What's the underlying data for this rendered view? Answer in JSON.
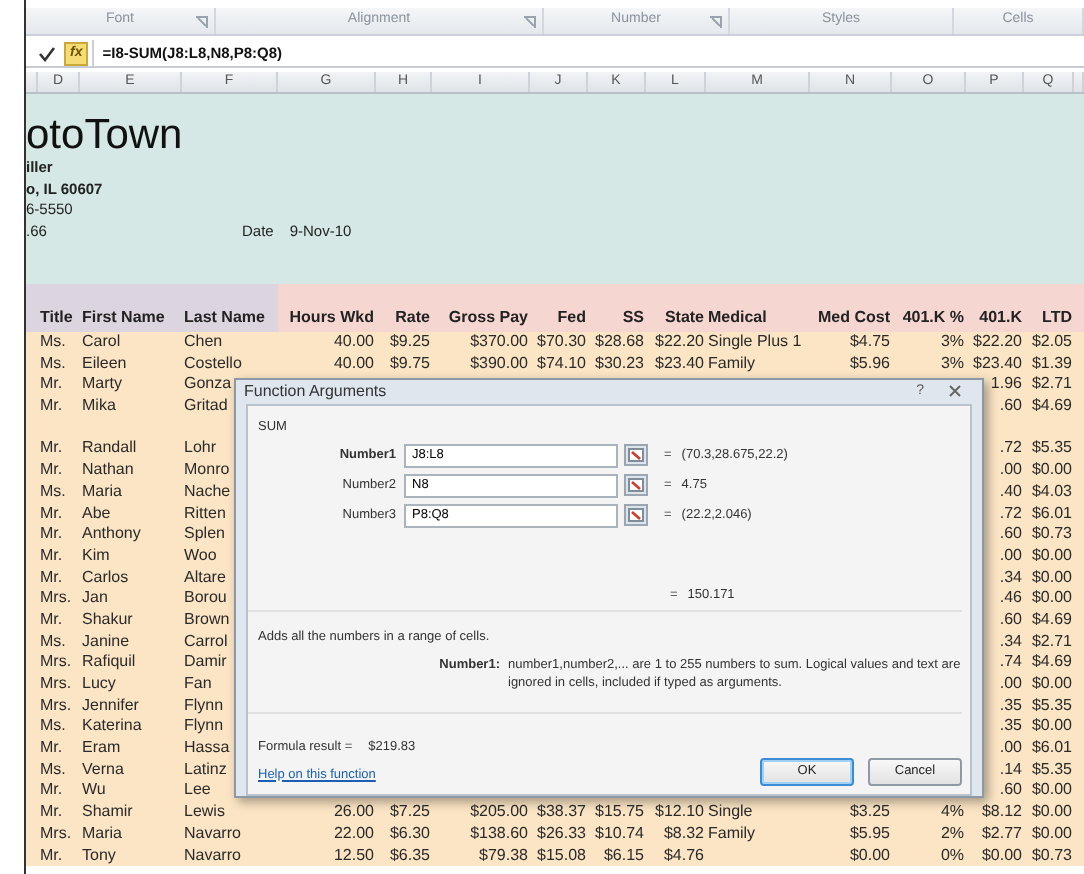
{
  "ribbon": {
    "groups": [
      {
        "label": "Font",
        "launcher": true
      },
      {
        "label": "Alignment",
        "launcher": true
      },
      {
        "label": "Number",
        "launcher": true
      },
      {
        "label": "Styles",
        "launcher": false
      },
      {
        "label": "Cells",
        "launcher": false
      }
    ]
  },
  "formula_bar": {
    "fx_label": "fx",
    "formula": "=I8-SUM(J8:L8,N8,P8:Q8)"
  },
  "column_headers": [
    "D",
    "E",
    "F",
    "G",
    "H",
    "I",
    "J",
    "K",
    "L",
    "M",
    "N",
    "O",
    "P",
    "Q"
  ],
  "sheet_header": {
    "company": "otoTown",
    "lines": [
      {
        "text": "iller",
        "bold": true
      },
      {
        "text": "o, IL  60607",
        "bold": true
      },
      {
        "text": "6-5550",
        "bold": false
      },
      {
        "text": ".66",
        "bold": false
      }
    ],
    "date_label": "Date",
    "date": "9-Nov-10"
  },
  "table": {
    "columns": [
      {
        "label": "Title",
        "kind": "text"
      },
      {
        "label": "First Name",
        "kind": "text"
      },
      {
        "label": "Last Name",
        "kind": "text"
      },
      {
        "label": "Hours Wkd",
        "kind": "number"
      },
      {
        "label": "Rate",
        "kind": "number"
      },
      {
        "label": "Gross Pay",
        "kind": "number"
      },
      {
        "label": "Fed",
        "kind": "number"
      },
      {
        "label": "SS",
        "kind": "number"
      },
      {
        "label": "State",
        "kind": "number"
      },
      {
        "label": "Medical",
        "kind": "text"
      },
      {
        "label": "Med Cost",
        "kind": "number"
      },
      {
        "label": "401.K %",
        "kind": "number"
      },
      {
        "label": "401.K",
        "kind": "number"
      },
      {
        "label": "LTD",
        "kind": "number"
      }
    ],
    "rows": [
      {
        "cells": [
          "Ms.",
          "Carol",
          "Chen",
          "40.00",
          "$9.25",
          "$370.00",
          "$70.30",
          "$28.68",
          "$22.20",
          "Single Plus 1",
          "$4.75",
          "3%",
          "$22.20",
          "$2.05"
        ]
      },
      {
        "cells": [
          "Ms.",
          "Eileen",
          "Costello",
          "40.00",
          "$9.75",
          "$390.00",
          "$74.10",
          "$30.23",
          "$23.40",
          "Family",
          "$5.96",
          "3%",
          "$23.40",
          "$1.39"
        ]
      },
      {
        "cells": [
          "Mr.",
          "Marty",
          "Gonza",
          null,
          null,
          null,
          null,
          null,
          null,
          null,
          null,
          null,
          "1.96",
          "$2.71"
        ]
      },
      {
        "cells": [
          "Mr.",
          "Mika",
          "Gritad",
          null,
          null,
          null,
          null,
          null,
          null,
          null,
          null,
          null,
          ".60",
          "$4.69"
        ]
      },
      {
        "blank_row_before": true,
        "cells": [
          "Mr.",
          "Randall",
          "Lohr",
          null,
          null,
          null,
          null,
          null,
          null,
          null,
          null,
          null,
          ".72",
          "$5.35"
        ]
      },
      {
        "cells": [
          "Mr.",
          "Nathan",
          "Monro",
          null,
          null,
          null,
          null,
          null,
          null,
          null,
          null,
          null,
          ".00",
          "$0.00"
        ]
      },
      {
        "cells": [
          "Ms.",
          "Maria",
          "Nache",
          null,
          null,
          null,
          null,
          null,
          null,
          null,
          null,
          null,
          ".40",
          "$4.03"
        ]
      },
      {
        "cells": [
          "Mr.",
          "Abe",
          "Ritten",
          null,
          null,
          null,
          null,
          null,
          null,
          null,
          null,
          null,
          ".72",
          "$6.01"
        ]
      },
      {
        "cells": [
          "Mr.",
          "Anthony",
          "Splen",
          null,
          null,
          null,
          null,
          null,
          null,
          null,
          null,
          null,
          ".60",
          "$0.73"
        ]
      },
      {
        "cells": [
          "Mr.",
          "Kim",
          "Woo",
          null,
          null,
          null,
          null,
          null,
          null,
          null,
          null,
          null,
          ".00",
          "$0.00"
        ]
      },
      {
        "cells": [
          "Mr.",
          "Carlos",
          "Altare",
          null,
          null,
          null,
          null,
          null,
          null,
          null,
          null,
          null,
          ".34",
          "$0.00"
        ]
      },
      {
        "cells": [
          "Mrs.",
          "Jan",
          "Borou",
          null,
          null,
          null,
          null,
          null,
          null,
          null,
          null,
          null,
          ".46",
          "$0.00"
        ]
      },
      {
        "cells": [
          "Mr.",
          "Shakur",
          "Brown",
          null,
          null,
          null,
          null,
          null,
          null,
          null,
          null,
          null,
          ".60",
          "$4.69"
        ]
      },
      {
        "cells": [
          "Ms.",
          "Janine",
          "Carrol",
          null,
          null,
          null,
          null,
          null,
          null,
          null,
          null,
          null,
          ".34",
          "$2.71"
        ]
      },
      {
        "cells": [
          "Mrs.",
          "Rafiquil",
          "Damir",
          null,
          null,
          null,
          null,
          null,
          null,
          null,
          null,
          null,
          ".74",
          "$4.69"
        ]
      },
      {
        "cells": [
          "Mrs.",
          "Lucy",
          "Fan",
          null,
          null,
          null,
          null,
          null,
          null,
          null,
          null,
          null,
          ".00",
          "$0.00"
        ]
      },
      {
        "cells": [
          "Mrs.",
          "Jennifer",
          "Flynn",
          null,
          null,
          null,
          null,
          null,
          null,
          null,
          null,
          null,
          ".35",
          "$5.35"
        ]
      },
      {
        "cells": [
          "Ms.",
          "Katerina",
          "Flynn",
          null,
          null,
          null,
          null,
          null,
          null,
          null,
          null,
          null,
          ".35",
          "$0.00"
        ]
      },
      {
        "cells": [
          "Mr.",
          "Eram",
          "Hassa",
          null,
          null,
          null,
          null,
          null,
          null,
          null,
          null,
          null,
          ".00",
          "$6.01"
        ]
      },
      {
        "cells": [
          "Ms.",
          "Verna",
          "Latinz",
          null,
          null,
          null,
          null,
          null,
          null,
          null,
          null,
          null,
          ".14",
          "$5.35"
        ]
      },
      {
        "cells": [
          "Mr.",
          "Wu",
          "Lee",
          null,
          null,
          null,
          null,
          null,
          null,
          null,
          null,
          null,
          ".60",
          "$0.00"
        ]
      },
      {
        "cells": [
          "Mr.",
          "Shamir",
          "Lewis",
          "26.00",
          "$7.25",
          "$205.00",
          "$38.37",
          "$15.75",
          "$12.10",
          "Single",
          "$3.25",
          "4%",
          "$8.12",
          "$0.00"
        ]
      },
      {
        "cells": [
          "Mrs.",
          "Maria",
          "Navarro",
          "22.00",
          "$6.30",
          "$138.60",
          "$26.33",
          "$10.74",
          "$8.32",
          "Family",
          "$5.95",
          "2%",
          "$2.77",
          "$0.00"
        ]
      },
      {
        "cells": [
          "Mr.",
          "Tony",
          "Navarro",
          "12.50",
          "$6.35",
          "$79.38",
          "$15.08",
          "$6.15",
          "$4.76",
          null,
          "$0.00",
          "0%",
          "$0.00",
          "$0.73"
        ]
      }
    ]
  },
  "dialog": {
    "title": "Function Arguments",
    "help_button": "?",
    "function_name": "SUM",
    "arguments": [
      {
        "label": "Number1",
        "selected": true,
        "value": "J8:L8",
        "sign": "=",
        "result": "(70.3,28.675,22.2)"
      },
      {
        "label": "Number2",
        "selected": false,
        "value": "N8",
        "sign": "=",
        "result": "4.75"
      },
      {
        "label": "Number3",
        "selected": false,
        "value": "P8:Q8",
        "sign": "=",
        "result": "(22.2,2.046)"
      }
    ],
    "total_sign": "=",
    "total": "150.171",
    "description": "Adds all the numbers in a range of cells.",
    "argument_help_label": "Number1:",
    "argument_help": "number1,number2,... are 1 to 255 numbers to sum. Logical values and text are ignored in cells, included if typed as arguments.",
    "formula_result_label": "Formula result =",
    "formula_result": "$219.83",
    "help_link": "Help on this function",
    "buttons": [
      {
        "label": "OK",
        "selected": true
      },
      {
        "label": "Cancel",
        "selected": false
      }
    ]
  }
}
